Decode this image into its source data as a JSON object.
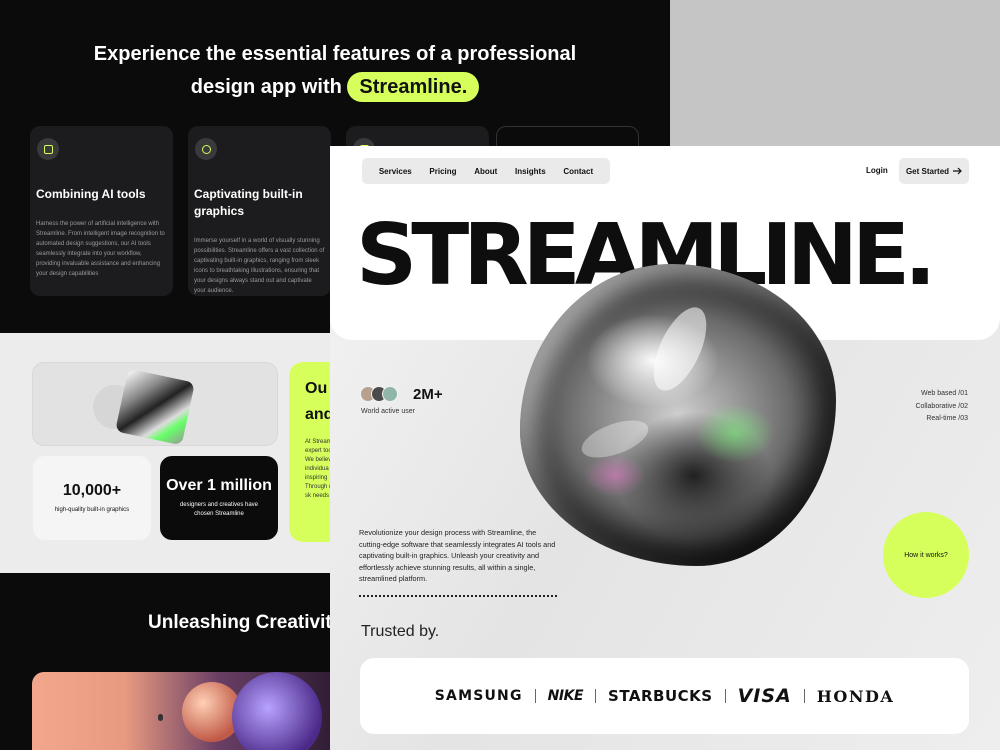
{
  "back_page": {
    "headline_part1": "Experience the essential features of a professional",
    "headline_part2": "design app with",
    "headline_highlight": "Streamline.",
    "cards": [
      {
        "title": "Combining AI tools",
        "body": "Harness the power of artificial intelligence with Streamline. From intelligent image recognition to automated design suggestions, our AI tools seamlessly integrate into your workflow, providing invaluable assistance and enhancing your design capabilities",
        "icon": "cpu-icon"
      },
      {
        "title": "Captivating built-in graphics",
        "body": "Immerse yourself in a world of visually stunning possibilities. Streamline offers a vast collection of captivating built-in graphics, ranging from sleek icons to breathtaking illustrations, ensuring that your designs always stand out and captivate your audience.",
        "icon": "graphics-icon"
      }
    ],
    "stats": [
      {
        "value": "10,000+",
        "label": "high-quality built-in graphics"
      },
      {
        "value": "Over 1 million",
        "label": "designers and creatives have chosen Streamline"
      }
    ],
    "lime_card": {
      "title_line1": "Ou",
      "title_line2": "and",
      "body": "At Stream of expert tools and We believ individua inspiring Through design sk needs an"
    },
    "section_title": "Unleashing Creativit"
  },
  "front_page": {
    "nav": [
      "Services",
      "Pricing",
      "About",
      "Insights",
      "Contact"
    ],
    "login_label": "Login",
    "cta_label": "Get Started",
    "brand": "STREAMLINE.",
    "users_count": "2M+",
    "users_label": "World active user",
    "features": [
      "Web based /01",
      "Collaborative /02",
      "Real-time /03"
    ],
    "description": "Revolutionize your design process with Streamline, the cutting-edge software that seamlessly integrates AI tools and captivating built-in graphics. Unleash your creativity and effortlessly achieve stunning results, all within a single, streamlined platform.",
    "how_label": "How it works?",
    "trusted_label": "Trusted by.",
    "logos": [
      "SAMSUNG",
      "NIKE",
      "STARBUCKS",
      "VISA",
      "HONDA"
    ]
  },
  "colors": {
    "accent": "#d6ff5c",
    "dark": "#0b0b0c",
    "card": "#1c1c1e"
  }
}
